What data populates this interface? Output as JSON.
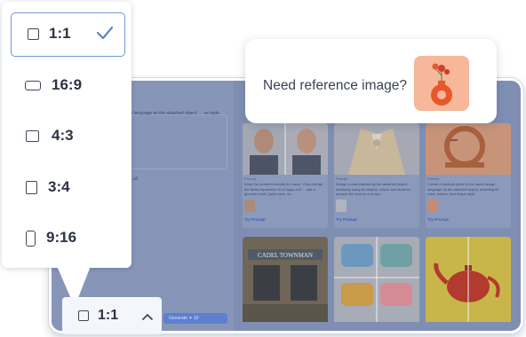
{
  "dropdown": {
    "options": [
      {
        "label": "1:1",
        "selected": true
      },
      {
        "label": "16:9",
        "selected": false
      },
      {
        "label": "4:3",
        "selected": false
      },
      {
        "label": "3:4",
        "selected": false
      },
      {
        "label": "9:16",
        "selected": false
      }
    ],
    "icon": "check-icon"
  },
  "ratio_button": {
    "label": "1:1",
    "icon": "chevron-up-icon"
  },
  "reference": {
    "text": "Need reference image?"
  },
  "app": {
    "description": "...e design language as the attached object. ... ve style.",
    "small_label": "...all",
    "generate_label": "Generate",
    "generate_cost": "✦ 10",
    "cards": [
      {
        "meta": "Prompt",
        "desc": "Keep the person's identity the same. Only change the facial expression to a happy and ... add a genuine smile, joyful eyes, an...",
        "try": "Try Prompt"
      },
      {
        "meta": "Prompt",
        "desc": "Design a coat inspired by the attached object, creatively using its shapes, colors, and textures; present the coat on a runwa...",
        "try": "Try Prompt"
      },
      {
        "meta": "Prompt",
        "desc": "Create a furniture piece in the same design language as the attached object, matching its color, texture, and shape style.",
        "try": "Try Prompt"
      }
    ],
    "store_sign": "CADEL TOWNMAN"
  },
  "colors": {
    "accent": "#6f98dd",
    "app_bg": "#7f8fb3",
    "ref_thumb_bg": "#f6b79a"
  }
}
